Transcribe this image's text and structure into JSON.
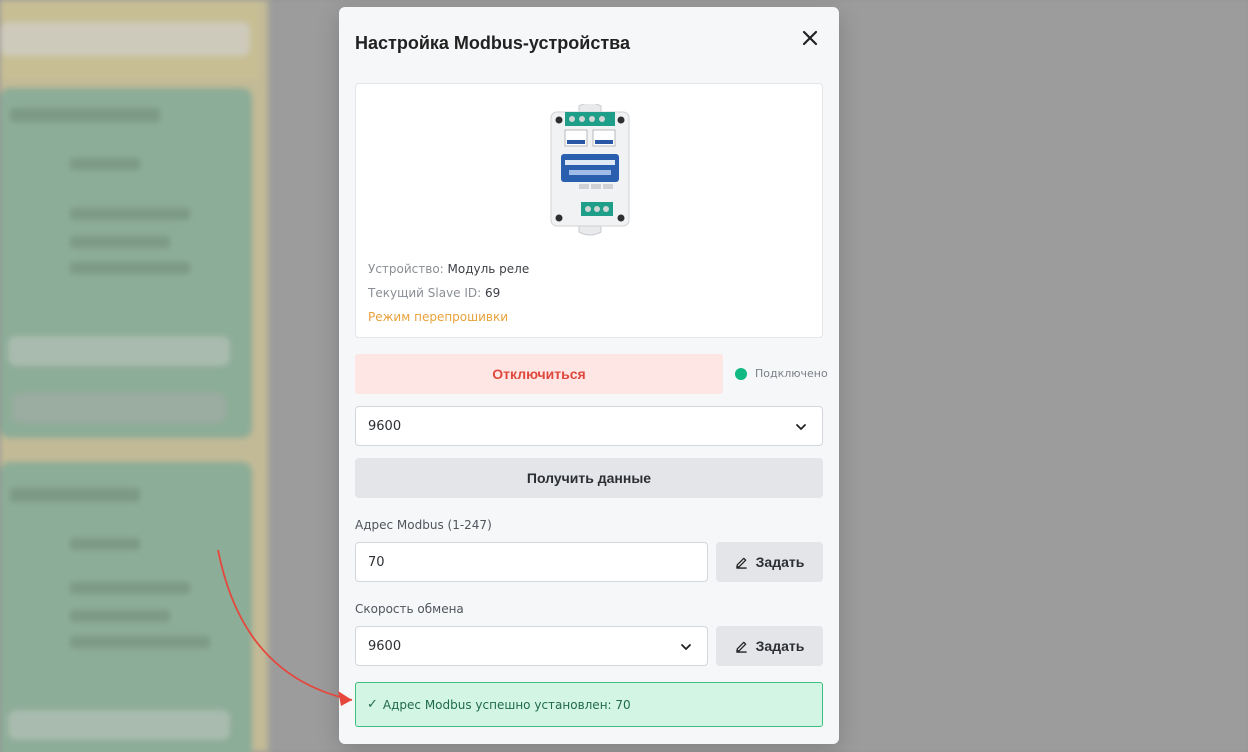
{
  "modal": {
    "title": "Настройка Modbus-устройства"
  },
  "device": {
    "device_label": "Устройство: ",
    "device_value": "Модуль реле",
    "slave_label": "Текущий Slave ID: ",
    "slave_value": "69",
    "mode_text": "Режим перепрошивки"
  },
  "connection": {
    "disconnect_label": "Отключиться",
    "status_text": "Подключено",
    "status_color": "#10b981"
  },
  "port_baud": {
    "selected": "9600"
  },
  "get_data_label": "Получить данные",
  "address": {
    "label": "Адрес Modbus (1-247)",
    "value": "70",
    "set_label": "Задать"
  },
  "speed": {
    "label": "Скорость обмена",
    "selected": "9600",
    "set_label": "Задать"
  },
  "success": {
    "check": "✓",
    "message": "Адрес Modbus успешно установлен: 70"
  },
  "colors": {
    "danger": "#e0483d",
    "success_bg": "#d3f5e4",
    "annotation_arrow": "#e5473c"
  }
}
